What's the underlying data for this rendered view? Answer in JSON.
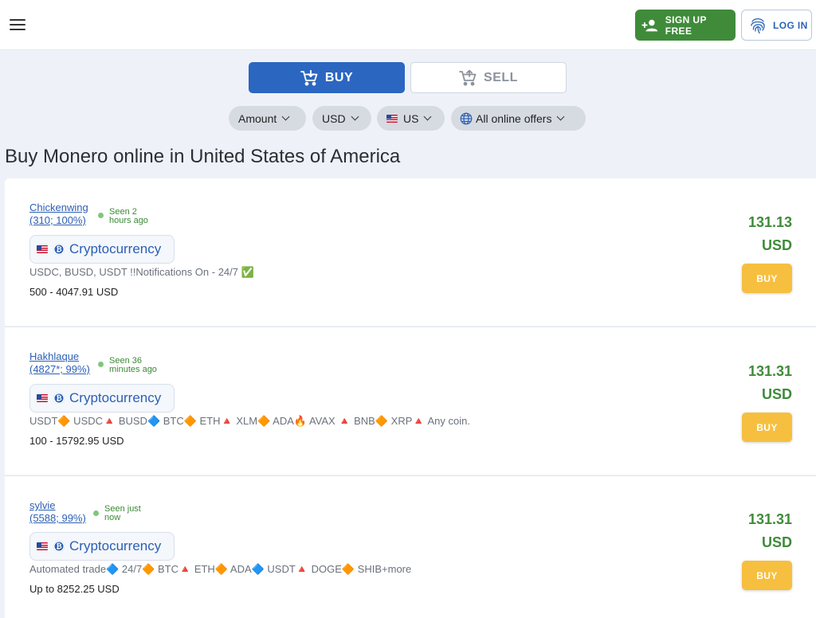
{
  "header": {
    "signup_label": "SIGN UP FREE",
    "login_label": "LOG IN"
  },
  "trade_tabs": {
    "buy_label": "BUY",
    "sell_label": "SELL",
    "active": "buy"
  },
  "filters": {
    "amount_label": "Amount",
    "currency_label": "USD",
    "country_label": "US",
    "offers_label": "All online offers"
  },
  "page_title": "Buy Monero online in United States of America",
  "listings": [
    {
      "seller_name": "Chickenwing",
      "seller_stats": "(310; 100%)",
      "seen_line1": "Seen 2",
      "seen_line2": "hours ago",
      "payment_method": "Cryptocurrency",
      "terms": "USDC, BUSD, USDT !!Notifications On - 24/7 ✅",
      "limits": "500 - 4047.91 USD",
      "price": "131.13",
      "price_currency": "USD",
      "buy_label": "BUY"
    },
    {
      "seller_name": "Hakhlaque",
      "seller_stats": "(4827*; 99%)",
      "seen_line1": "Seen 36",
      "seen_line2": "minutes ago",
      "payment_method": "Cryptocurrency",
      "terms": "USDT🔶 USDC🔺 BUSD🔷 BTC🔶 ETH🔺 XLM🔶 ADA🔥 AVAX 🔺 BNB🔶 XRP🔺 Any coin.",
      "limits": "100 - 15792.95 USD",
      "price": "131.31",
      "price_currency": "USD",
      "buy_label": "BUY"
    },
    {
      "seller_name": "sylvie",
      "seller_stats": "(5588; 99%)",
      "seen_line1": "Seen just",
      "seen_line2": "now",
      "payment_method": "Cryptocurrency",
      "terms": "Automated trade🔷 24/7🔶 BTC🔺 ETH🔶 ADA🔷 USDT🔺 DOGE🔶 SHIB+more",
      "limits": "Up to 8252.25 USD",
      "price": "131.31",
      "price_currency": "USD",
      "buy_label": "BUY"
    }
  ],
  "colors": {
    "primary": "#2b66c1",
    "success": "#3f8b3a",
    "buy_button": "#f7bf3f",
    "background": "#eef2f8"
  },
  "icons": {
    "menu": "hamburger-menu-icon",
    "signup": "add-user-icon",
    "login": "fingerprint-icon",
    "cart": "cart-icon",
    "globe": "globe-icon",
    "flag": "us-flag-icon",
    "coin": "bitcoin-coin-icon"
  }
}
